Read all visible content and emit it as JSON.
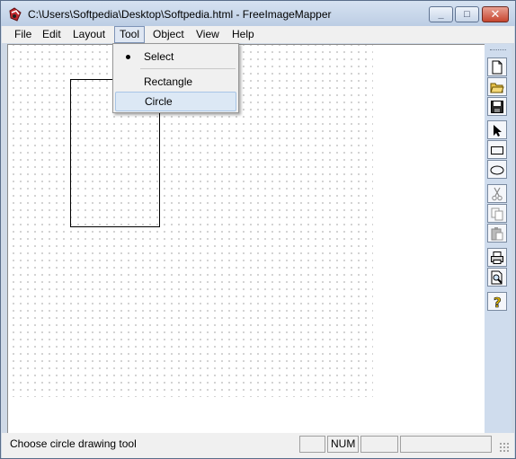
{
  "window": {
    "title": "C:\\Users\\Softpedia\\Desktop\\Softpedia.html - FreeImageMapper"
  },
  "menu": [
    {
      "label": "File"
    },
    {
      "label": "Edit"
    },
    {
      "label": "Layout"
    },
    {
      "label": "Tool"
    },
    {
      "label": "Object"
    },
    {
      "label": "View"
    },
    {
      "label": "Help"
    }
  ],
  "tool_menu": {
    "items": [
      {
        "label": "Select",
        "checked": true
      },
      {
        "label": "Rectangle",
        "checked": false
      },
      {
        "label": "Circle",
        "checked": false,
        "highlighted": true
      }
    ]
  },
  "toolbar": {
    "buttons": [
      "new-document-icon",
      "open-folder-icon",
      "save-icon",
      "select-arrow-icon",
      "rectangle-tool-icon",
      "circle-tool-icon",
      "cut-icon",
      "copy-icon",
      "paste-icon",
      "print-icon",
      "print-preview-icon",
      "help-icon"
    ]
  },
  "statusbar": {
    "message": "Choose circle drawing tool",
    "num": "NUM"
  },
  "colors": {
    "titlebar": "#c9d7ea",
    "menu_highlight": "#dce8f5",
    "close_button": "#c6462f"
  }
}
